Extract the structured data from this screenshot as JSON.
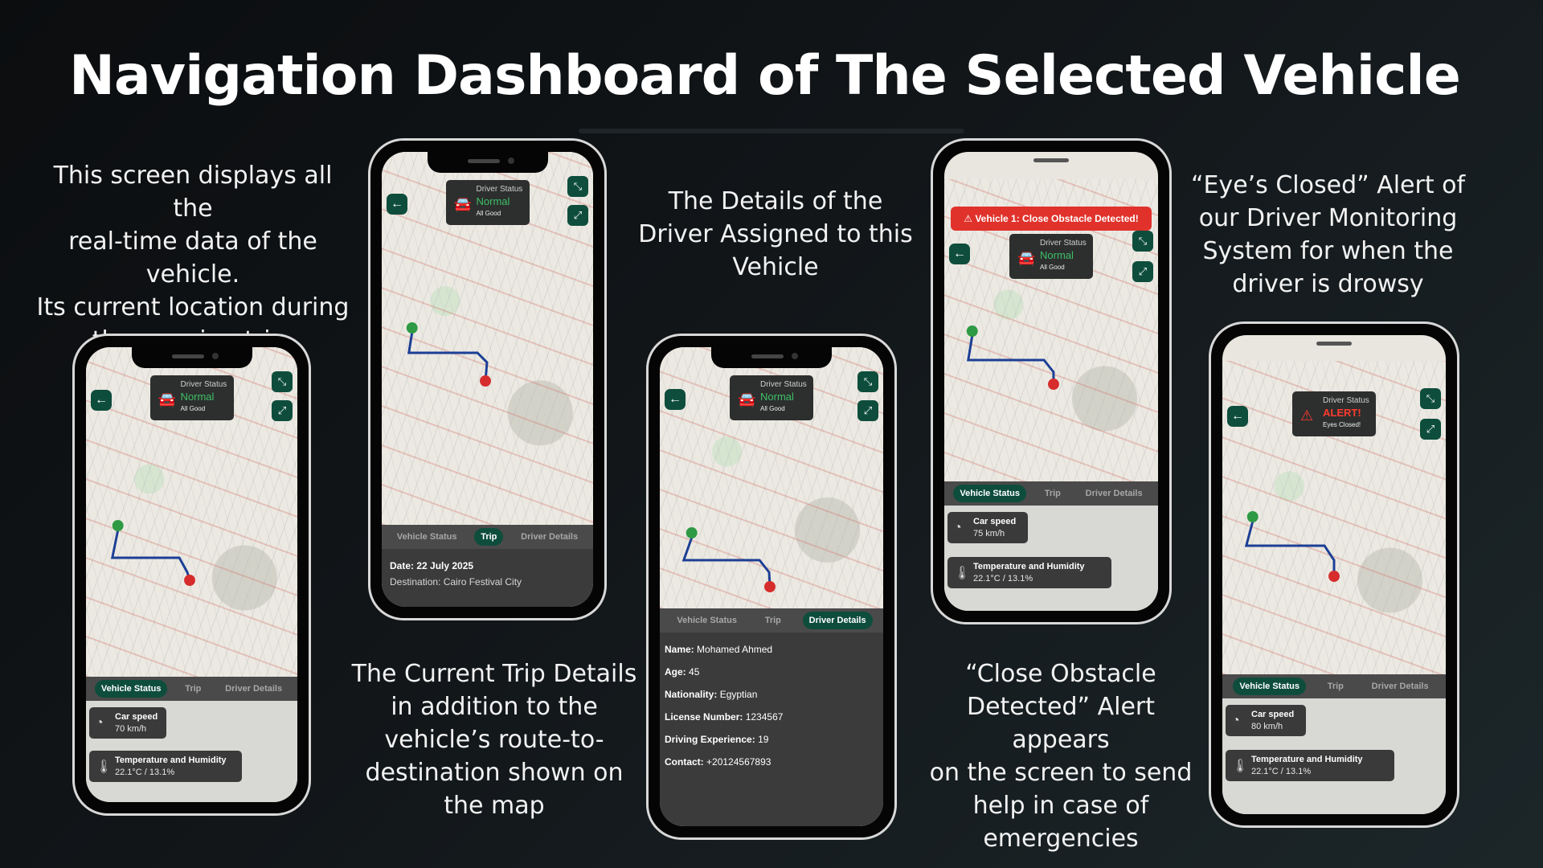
{
  "title": "Navigation Dashboard of The Selected Vehicle",
  "captions": {
    "c1": "This screen displays all the\nreal-time data of the\nvehicle.\nIts current location during\nthe ongoing trip.",
    "c2": "The Current Trip Details\nin addition to the\nvehicle’s route-to-\ndestination shown on\nthe map",
    "c3": "The Details of the\nDriver Assigned to this\nVehicle",
    "c4": "“Close Obstacle\nDetected” Alert appears\non the screen to send\nhelp in case of\nemergencies",
    "c5": "“Eye’s Closed” Alert of\nour Driver Monitoring\nSystem for when the\ndriver is drowsy"
  },
  "tabs": {
    "vehicle_status": "Vehicle Status",
    "trip": "Trip",
    "driver_details": "Driver Details"
  },
  "driver_card": {
    "title": "Driver Status",
    "normal_status": "Normal",
    "normal_note": "All Good",
    "alert_status": "ALERT!",
    "alert_note": "Eyes Closed!"
  },
  "vehicle": {
    "speed_label": "Car speed",
    "temp_label": "Temperature and Humidity",
    "temp_value": "22.1°C / 13.1%",
    "speed_phone1": "70 km/h",
    "speed_phone4": "75 km/h",
    "speed_phone5": "80 km/h"
  },
  "trip": {
    "date": "Date: 22 July 2025",
    "destination": "Destination: Cairo Festival City"
  },
  "driver": {
    "name_label": "Name:",
    "name": "Mohamed Ahmed",
    "age_label": "Age:",
    "age": "45",
    "nationality_label": "Nationality:",
    "nationality": "Egyptian",
    "license_label": "License Number:",
    "license": "1234567",
    "experience_label": "Driving Experience:",
    "experience": "19",
    "contact_label": "Contact:",
    "contact": "+20124567893"
  },
  "alert_banner": "Vehicle 1: Close Obstacle Detected!",
  "icons": {
    "back": "arrow-left-icon",
    "collapse": "collapse-icon",
    "expand": "expand-icon",
    "car": "car-icon",
    "warning": "warning-icon",
    "speed": "speedometer-icon",
    "temp": "thermometer-icon"
  },
  "colors": {
    "accent": "#0e4d3c",
    "normal": "#3fbf67",
    "alert": "#e0322b"
  }
}
